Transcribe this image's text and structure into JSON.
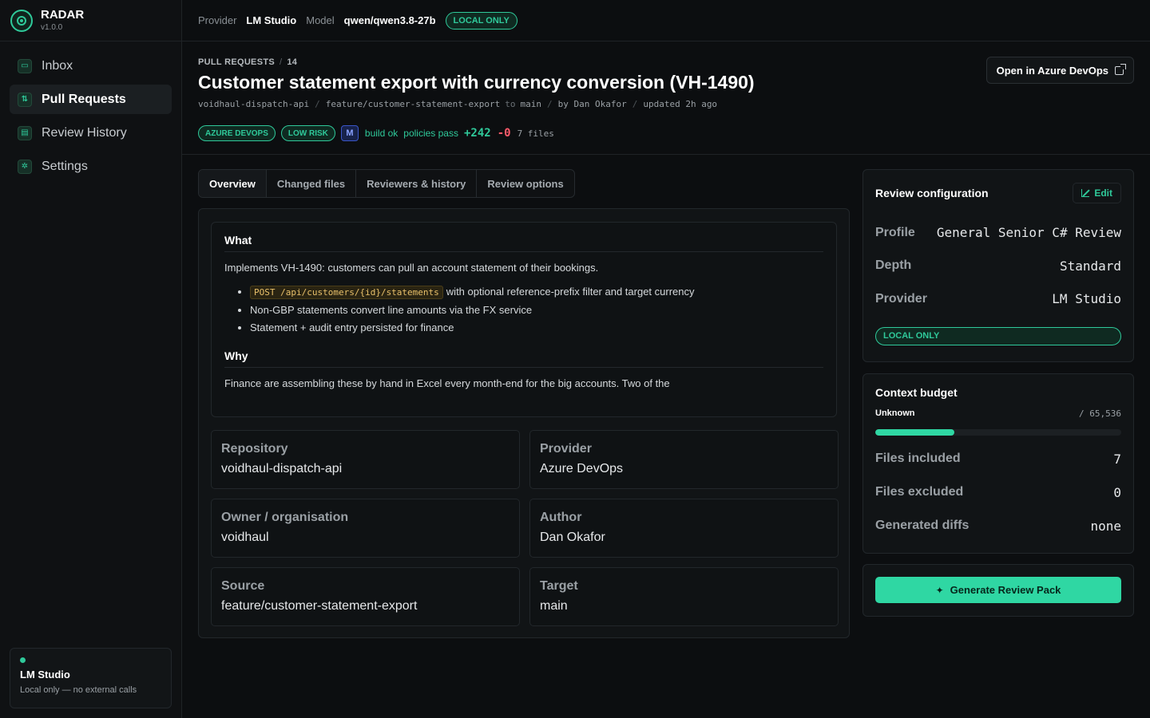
{
  "brand": {
    "name": "RADAR",
    "version": "v1.0.0"
  },
  "sidebar": {
    "items": [
      {
        "label": "Inbox",
        "icon": "inbox-icon",
        "glyph": "▭"
      },
      {
        "label": "Pull Requests",
        "icon": "pull-request-icon",
        "glyph": "⇅"
      },
      {
        "label": "Review History",
        "icon": "history-icon",
        "glyph": "▤"
      },
      {
        "label": "Settings",
        "icon": "gear-icon",
        "glyph": "✲"
      }
    ],
    "status": {
      "title": "LM Studio",
      "subtitle": "Local only — no external calls"
    }
  },
  "topbar": {
    "provider_label": "Provider",
    "provider_value": "LM Studio",
    "model_label": "Model",
    "model_value": "qwen/qwen3.8-27b",
    "badge": "LOCAL ONLY"
  },
  "pr": {
    "crumb_section": "PULL REQUESTS",
    "crumb_number": "14",
    "title": "Customer statement export with currency conversion (VH-1490)",
    "repo": "voidhaul-dispatch-api",
    "source_branch": "feature/customer-statement-export",
    "to": "to",
    "target_branch": "main",
    "author": "by Dan Okafor",
    "updated": "updated 2h ago",
    "badges": {
      "platform": "AZURE DEVOPS",
      "risk": "LOW RISK",
      "merge": "M"
    },
    "build": "build ok",
    "policies": "policies pass",
    "additions": "+242",
    "deletions": "-0",
    "files": "7 files",
    "open_button": "Open in Azure DevOps"
  },
  "tabs": [
    "Overview",
    "Changed files",
    "Reviewers & history",
    "Review options"
  ],
  "overview": {
    "what_heading": "What",
    "what_text": "Implements VH-1490: customers can pull an account statement of their bookings.",
    "bullet1_code": "POST /api/customers/{id}/statements",
    "bullet1_text": "with optional reference-prefix filter and target currency",
    "bullet2": "Non-GBP statements convert line amounts via the FX service",
    "bullet3": "Statement + audit entry persisted for finance",
    "why_heading": "Why",
    "why_text": "Finance are assembling these by hand in Excel every month-end for the big accounts. Two of the",
    "details": [
      {
        "key": "Repository",
        "value": "voidhaul-dispatch-api"
      },
      {
        "key": "Provider",
        "value": "Azure DevOps"
      },
      {
        "key": "Owner / organisation",
        "value": "voidhaul"
      },
      {
        "key": "Author",
        "value": "Dan Okafor"
      },
      {
        "key": "Source",
        "value": "feature/customer-statement-export"
      },
      {
        "key": "Target",
        "value": "main"
      }
    ]
  },
  "review_config": {
    "title": "Review configuration",
    "edit_label": "Edit",
    "profile_label": "Profile",
    "profile_value": "General Senior C# Review",
    "depth_label": "Depth",
    "depth_value": "Standard",
    "provider_label": "Provider",
    "provider_value": "LM Studio",
    "badge": "LOCAL ONLY"
  },
  "context_budget": {
    "title": "Context budget",
    "used_label": "Unknown",
    "limit": "/ 65,536",
    "progress_percent": 32,
    "files_included_label": "Files included",
    "files_included_value": "7",
    "files_excluded_label": "Files excluded",
    "files_excluded_value": "0",
    "generated_diffs_label": "Generated diffs",
    "generated_diffs_value": "none"
  },
  "generate_button": "Generate Review Pack",
  "colors": {
    "accent": "#2fd7a3",
    "danger": "#ff5a6a",
    "background": "#0c0e10"
  }
}
